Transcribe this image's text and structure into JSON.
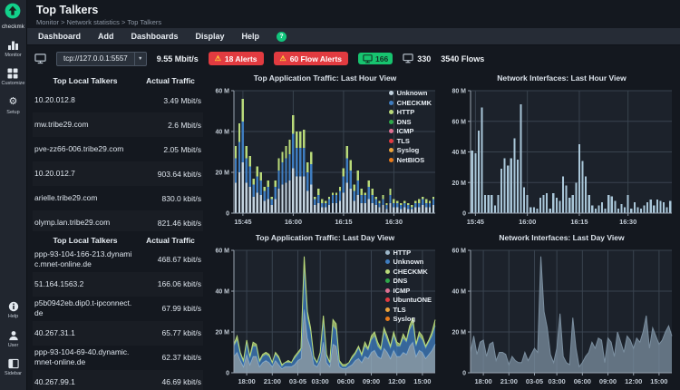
{
  "app": {
    "brand": "checkmk"
  },
  "sidebar": {
    "items": [
      {
        "id": "monitor",
        "label": "Monitor",
        "icon": "bar-chart-icon"
      },
      {
        "id": "customize",
        "label": "Customize",
        "icon": "grid-icon"
      },
      {
        "id": "setup",
        "label": "Setup",
        "icon": "gear-icon"
      }
    ],
    "bottom_items": [
      {
        "id": "help",
        "label": "Help",
        "icon": "info-icon"
      },
      {
        "id": "user",
        "label": "User",
        "icon": "user-icon"
      },
      {
        "id": "sidebar",
        "label": "Sidebar",
        "icon": "sidebar-icon"
      }
    ]
  },
  "header": {
    "title": "Top Talkers",
    "breadcrumb": "Monitor > Network statistics > Top Talkers"
  },
  "menu": {
    "items": [
      "Dashboard",
      "Add",
      "Dashboards",
      "Display",
      "Help"
    ]
  },
  "toolbar": {
    "source_select": "tcp://127.0.0.1:5557",
    "bandwidth": "9.55 Mbit/s",
    "alerts_badge": "18 Alerts",
    "flow_alerts_badge": "60 Flow Alerts",
    "active_hosts": "166",
    "total_hosts": "330",
    "flows": "3540 Flows"
  },
  "tables": [
    {
      "headers": [
        "Top Local Talkers",
        "Actual Traffic"
      ],
      "rows": [
        [
          "10.20.012.8",
          "3.49 Mbit/s"
        ],
        [
          "mw.tribe29.com",
          "2.6 Mbit/s"
        ],
        [
          "pve-zz66-006.tribe29.com",
          "2.05 Mbit/s"
        ],
        [
          "10.20.012.7",
          "903.64 kbit/s"
        ],
        [
          "arielle.tribe29.com",
          "830.0 kbit/s"
        ],
        [
          "olymp.lan.tribe29.com",
          "821.46 kbit/s"
        ]
      ]
    },
    {
      "headers": [
        "Top Local Talkers",
        "Actual Traffic"
      ],
      "rows": [
        [
          "ppp-93-104-166-213.dynamic.mnet-online.de",
          "468.67 kbit/s"
        ],
        [
          "51.164.1563.2",
          "166.06 kbit/s"
        ],
        [
          "p5b0942eb.dip0.t-ipconnect.de",
          "67.99 kbit/s"
        ],
        [
          "40.267.31.1",
          "65.77 kbit/s"
        ],
        [
          "ppp-93-104-69-40.dynamic.mnet-online.de",
          "62.37 kbit/s"
        ],
        [
          "40.267.99.1",
          "46.69 kbit/s"
        ]
      ]
    }
  ],
  "colors": {
    "brand_green": "#12d18b",
    "alert_red": "#e23b40",
    "badge_green": "#17c46f",
    "plot_bg": "#1c222b",
    "grid": "#39434f",
    "axis": "#9aa5b2"
  },
  "chart_data": [
    {
      "type": "bar",
      "title": "Top Application Traffic: Last Hour View",
      "xlabel": "",
      "ylabel": "",
      "unit": "bit/s",
      "ylim": [
        0,
        60
      ],
      "grid": true,
      "legend_position": "top-right",
      "yticks": [
        {
          "v": 0,
          "label": "0"
        },
        {
          "v": 20,
          "label": "20 M"
        },
        {
          "v": 40,
          "label": "40 M"
        },
        {
          "v": 60,
          "label": "60 M"
        }
      ],
      "xticks": [
        {
          "i": 2,
          "label": "15:45"
        },
        {
          "i": 16,
          "label": "16:00"
        },
        {
          "i": 30,
          "label": "16:15"
        },
        {
          "i": 44,
          "label": "16:30"
        }
      ],
      "legend": [
        {
          "label": "Unknown",
          "color": "#c3d3df"
        },
        {
          "label": "CHECKMK",
          "color": "#3f7dc0"
        },
        {
          "label": "HTTP",
          "color": "#b9da7a"
        },
        {
          "label": "DNS",
          "color": "#2fa84a"
        },
        {
          "label": "ICMP",
          "color": "#df7193"
        },
        {
          "label": "TLS",
          "color": "#e23b41"
        },
        {
          "label": "Syslog",
          "color": "#eca33c"
        },
        {
          "label": "NetBIOS",
          "color": "#e87b1b"
        }
      ],
      "series": [
        {
          "name": "Unknown",
          "color": "#c3d3df",
          "values": [
            15,
            20,
            25,
            15,
            13,
            8,
            10,
            9,
            6,
            7,
            4,
            7,
            12,
            14,
            15,
            16,
            22,
            18,
            18,
            18,
            11,
            14,
            4,
            5,
            3,
            3,
            4,
            5,
            5,
            6,
            10,
            15,
            12,
            6,
            9,
            5,
            5,
            7,
            5,
            4,
            3,
            4,
            2,
            5,
            3,
            3,
            2,
            3,
            2,
            2,
            3,
            3,
            4,
            3,
            3,
            4
          ]
        },
        {
          "name": "CHECKMK",
          "color": "#3f7dc0",
          "values": [
            12,
            15,
            20,
            12,
            10,
            6,
            8,
            7,
            5,
            6,
            3,
            6,
            9,
            11,
            12,
            13,
            17,
            14,
            14,
            14,
            9,
            10,
            3,
            4,
            2,
            2,
            3,
            4,
            4,
            5,
            8,
            12,
            9,
            5,
            7,
            4,
            4,
            6,
            4,
            3,
            2,
            3,
            2,
            4,
            2,
            2,
            2,
            2,
            2,
            1,
            2,
            2,
            3,
            2,
            2,
            3
          ]
        },
        {
          "name": "HTTP",
          "color": "#b9da7a",
          "values": [
            6,
            9,
            11,
            6,
            5,
            3,
            5,
            4,
            2,
            3,
            1,
            3,
            6,
            5,
            6,
            7,
            9,
            8,
            8,
            9,
            5,
            6,
            1,
            3,
            2,
            1,
            1,
            1,
            1,
            2,
            4,
            6,
            5,
            3,
            5,
            3,
            1,
            3,
            3,
            1,
            1,
            2,
            1,
            3,
            2,
            1,
            1,
            1,
            1,
            1,
            1,
            2,
            1,
            2,
            1,
            1
          ]
        }
      ]
    },
    {
      "type": "bar",
      "title": "Network Interfaces: Last Hour View",
      "xlabel": "",
      "ylabel": "",
      "unit": "bit/s",
      "ylim": [
        0,
        80
      ],
      "grid": true,
      "legend_position": null,
      "yticks": [
        {
          "v": 0,
          "label": "0"
        },
        {
          "v": 20,
          "label": "20 M"
        },
        {
          "v": 40,
          "label": "40 M"
        },
        {
          "v": 60,
          "label": "60 M"
        },
        {
          "v": 80,
          "label": "80 M"
        }
      ],
      "xticks": [
        {
          "i": 1,
          "label": "15:45"
        },
        {
          "i": 17,
          "label": "16:00"
        },
        {
          "i": 33,
          "label": "16:15"
        },
        {
          "i": 48,
          "label": "16:30"
        }
      ],
      "legend": [],
      "series": [
        {
          "name": "Interfaces",
          "color": "#a9c6d8",
          "values": [
            41,
            39,
            54,
            69,
            12,
            12,
            12,
            5,
            12,
            29,
            36,
            31,
            36,
            49,
            35,
            71,
            17,
            12,
            4,
            4,
            3,
            10,
            12,
            13,
            3,
            13,
            10,
            8,
            24,
            18,
            10,
            12,
            20,
            45,
            34,
            24,
            12,
            5,
            3,
            5,
            7,
            3,
            12,
            11,
            8,
            3,
            6,
            4,
            12,
            3,
            7,
            4,
            3,
            5,
            7,
            9,
            5,
            9,
            8,
            7,
            4,
            8
          ]
        }
      ]
    },
    {
      "type": "area",
      "title": "Top Application Traffic: Last Day View",
      "xlabel": "",
      "ylabel": "",
      "unit": "bit/s",
      "ylim": [
        0,
        60
      ],
      "grid": true,
      "legend_position": "top-right",
      "yticks": [
        {
          "v": 0,
          "label": "0"
        },
        {
          "v": 20,
          "label": "20 M"
        },
        {
          "v": 40,
          "label": "40 M"
        },
        {
          "v": 60,
          "label": "60 M"
        }
      ],
      "xticks": [
        {
          "i": 4,
          "label": "18:00"
        },
        {
          "i": 12,
          "label": "21:00"
        },
        {
          "i": 20,
          "label": "03-05"
        },
        {
          "i": 27,
          "label": "03:00"
        },
        {
          "i": 35,
          "label": "06:00"
        },
        {
          "i": 43,
          "label": "09:00"
        },
        {
          "i": 51,
          "label": "12:00"
        },
        {
          "i": 59,
          "label": "15:00"
        }
      ],
      "legend": [
        {
          "label": "HTTP",
          "color": "#9db7c9"
        },
        {
          "label": "Unknown",
          "color": "#3f7dc0"
        },
        {
          "label": "CHECKMK",
          "color": "#b9da7a"
        },
        {
          "label": "DNS",
          "color": "#2fa84a"
        },
        {
          "label": "ICMP",
          "color": "#df7193"
        },
        {
          "label": "UbuntuONE",
          "color": "#e23b41"
        },
        {
          "label": "TLS",
          "color": "#eca33c"
        },
        {
          "label": "Syslog",
          "color": "#e87b1b"
        }
      ],
      "series": [
        {
          "name": "HTTP",
          "color": "#9db7c9",
          "values": [
            8,
            10,
            6,
            3,
            9,
            4,
            8,
            8,
            3,
            5,
            6,
            5,
            3,
            6,
            4,
            2,
            3,
            3,
            3,
            4,
            6,
            7,
            31,
            17,
            12,
            4,
            3,
            6,
            15,
            5,
            3,
            14,
            13,
            3,
            2,
            2,
            3,
            4,
            6,
            7,
            5,
            8,
            7,
            10,
            11,
            8,
            7,
            12,
            10,
            7,
            11,
            8,
            8,
            10,
            9,
            13,
            15,
            8,
            11,
            10,
            7,
            9,
            11,
            14
          ]
        },
        {
          "name": "Unknown",
          "color": "#3f7dc0",
          "values": [
            5,
            6,
            3,
            2,
            6,
            3,
            5,
            5,
            2,
            3,
            3,
            3,
            2,
            3,
            3,
            1,
            2,
            2,
            2,
            3,
            3,
            4,
            20,
            10,
            8,
            3,
            2,
            3,
            10,
            3,
            2,
            9,
            8,
            2,
            1,
            1,
            2,
            3,
            3,
            5,
            3,
            5,
            4,
            6,
            7,
            5,
            4,
            8,
            6,
            5,
            7,
            5,
            5,
            7,
            6,
            8,
            9,
            5,
            7,
            6,
            5,
            6,
            7,
            9
          ]
        },
        {
          "name": "CHECKMK",
          "color": "#b9da7a",
          "values": [
            1,
            2,
            1,
            1,
            1,
            1,
            2,
            1,
            1,
            1,
            1,
            1,
            0,
            1,
            1,
            1,
            0,
            1,
            0,
            1,
            1,
            1,
            6,
            3,
            2,
            1,
            0,
            1,
            3,
            1,
            0,
            3,
            3,
            1,
            1,
            1,
            0,
            1,
            1,
            1,
            1,
            2,
            1,
            2,
            2,
            2,
            1,
            2,
            2,
            1,
            2,
            2,
            1,
            2,
            1,
            2,
            3,
            1,
            2,
            2,
            1,
            1,
            2,
            3
          ]
        }
      ]
    },
    {
      "type": "area",
      "title": "Network Interfaces: Last Day View",
      "xlabel": "",
      "ylabel": "",
      "unit": "bit/s",
      "ylim": [
        0,
        60
      ],
      "grid": true,
      "legend_position": null,
      "yticks": [
        {
          "v": 0,
          "label": "0"
        },
        {
          "v": 20,
          "label": "20 M"
        },
        {
          "v": 40,
          "label": "40 M"
        },
        {
          "v": 60,
          "label": "60 M"
        }
      ],
      "xticks": [
        {
          "i": 4,
          "label": "18:00"
        },
        {
          "i": 12,
          "label": "21:00"
        },
        {
          "i": 20,
          "label": "03-05"
        },
        {
          "i": 27,
          "label": "03:00"
        },
        {
          "i": 35,
          "label": "06:00"
        },
        {
          "i": 43,
          "label": "09:00"
        },
        {
          "i": 51,
          "label": "12:00"
        },
        {
          "i": 59,
          "label": "15:00"
        }
      ],
      "legend": [],
      "series": [
        {
          "name": "Interfaces",
          "color": "#7b8fa0",
          "values": [
            10,
            18,
            9,
            15,
            16,
            8,
            14,
            15,
            6,
            10,
            10,
            9,
            4,
            8,
            6,
            5,
            5,
            10,
            6,
            9,
            12,
            10,
            57,
            30,
            22,
            9,
            5,
            12,
            29,
            8,
            5,
            4,
            27,
            12,
            3,
            5,
            8,
            10,
            15,
            12,
            17,
            16,
            5,
            17,
            15,
            8,
            20,
            15,
            10,
            18,
            16,
            12,
            17,
            15,
            20,
            28,
            12,
            22,
            18,
            14,
            16,
            20,
            23,
            18
          ]
        }
      ]
    }
  ]
}
